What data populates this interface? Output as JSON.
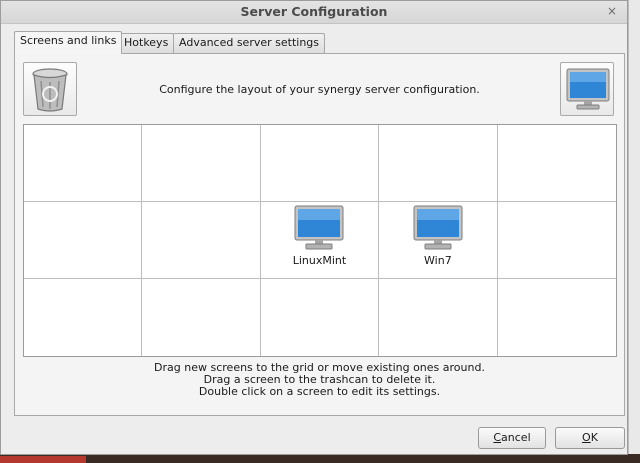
{
  "window": {
    "title": "Server Configuration",
    "close_glyph": "×"
  },
  "tabs": [
    {
      "label": "Screens and links",
      "active": true
    },
    {
      "label": "Hotkeys",
      "active": false
    },
    {
      "label": "Advanced server settings",
      "active": false
    }
  ],
  "panel": {
    "instruction": "Configure the layout of your synergy server configuration.",
    "trash_icon": "trash-can-icon",
    "new_screen_icon": "monitor-icon",
    "hints": [
      "Drag new screens to the grid or move existing ones around.",
      "Drag a screen to the trashcan to delete it.",
      "Double click on a screen to edit its settings."
    ]
  },
  "grid": {
    "rows": 3,
    "cols": 5,
    "screens": [
      {
        "name": "LinuxMint",
        "row": 2,
        "col": 3
      },
      {
        "name": "Win7",
        "row": 2,
        "col": 4
      }
    ]
  },
  "buttons": {
    "cancel": {
      "mnemonic": "C",
      "rest": "ancel"
    },
    "ok": {
      "mnemonic": "O",
      "rest": "K"
    }
  },
  "colors": {
    "screen_blue": "#2f86d6",
    "monitor_frame": "#b9b9b9"
  }
}
